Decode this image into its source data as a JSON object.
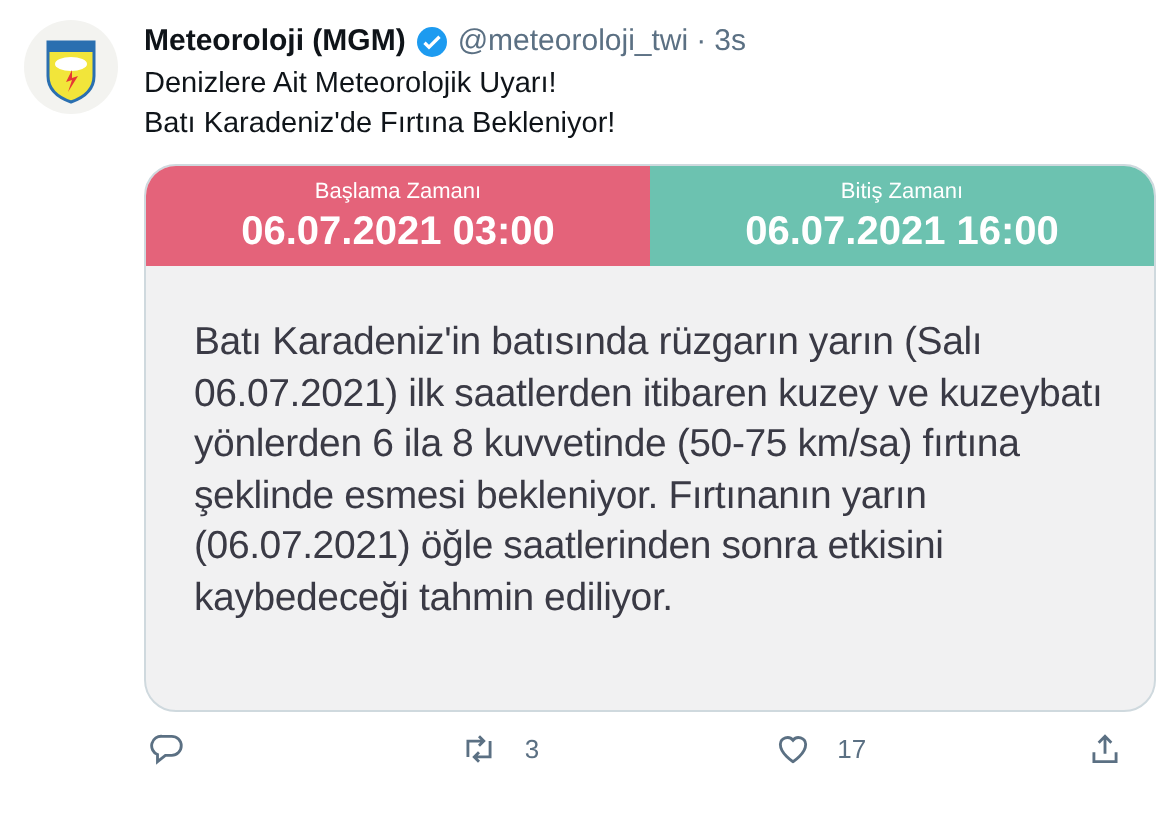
{
  "tweet": {
    "name": "Meteoroloji (MGM)",
    "verified": true,
    "handle": "@meteoroloji_twi",
    "separator": "·",
    "time": "3s",
    "lines": [
      "Denizlere Ait Meteorolojik Uyarı!",
      "Batı Karadeniz'de Fırtına Bekleniyor!"
    ]
  },
  "card": {
    "panels": [
      {
        "label": "Başlama Zamanı",
        "value": "06.07.2021 03:00",
        "color": "#e4637a"
      },
      {
        "label": "Bitiş Zamanı",
        "value": "06.07.2021 16:00",
        "color": "#6cc2b0"
      }
    ],
    "body": "Batı Karadeniz'in batısında rüzgarın yarın (Salı 06.07.2021) ilk saatlerden itibaren kuzey ve kuzeybatı yönlerden 6 ila 8 kuvvetinde (50-75 km/sa) fırtına şeklinde esmesi bekleniyor. Fırtınanın yarın (06.07.2021) öğle saatlerinden sonra etkisini kaybedeceği tahmin ediliyor."
  },
  "actions": [
    {
      "kind": "reply"
    },
    {
      "kind": "retweet",
      "count": "3"
    },
    {
      "kind": "like",
      "count": "17"
    },
    {
      "kind": "share"
    }
  ]
}
